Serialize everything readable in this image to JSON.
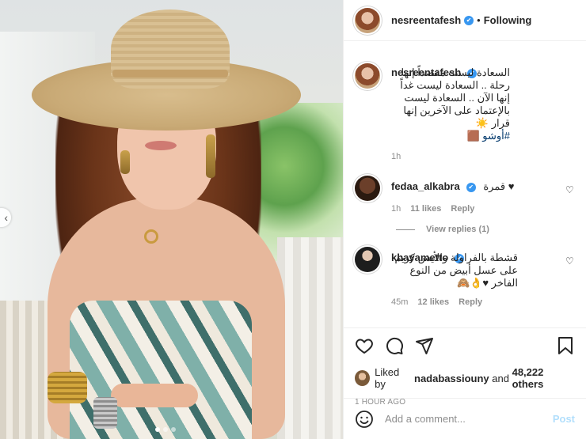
{
  "header": {
    "username": "nesreentafesh",
    "separator": "•",
    "follow_status": "Following"
  },
  "caption": {
    "username": "nesreentafesh",
    "text": "السعادة ليست مقصداً إنها رحلة .. السعادة ليست غداً إنها الآن .. السعادة ليست بالإعتماد على الآخرين إنها قرار ☀️",
    "hashtag": "#أوشو 🟫",
    "time": "1h"
  },
  "comments": [
    {
      "username": "fedaa_alkabra",
      "text": "قمرة ♥",
      "time": "1h",
      "likes": "11 likes",
      "reply": "Reply"
    },
    {
      "username": "khayametto",
      "text": "قشطة بالفراولة والأيس كريم على عسل أبيض من النوع الفاخر ♥👌🙈",
      "time": "45m",
      "likes": "12 likes",
      "reply": "Reply"
    }
  ],
  "view_replies": "View replies (1)",
  "liked_by": {
    "prefix": "Liked by",
    "user": "nadabassiouny",
    "and": "and",
    "others": "48,222 others"
  },
  "post_time": "1 HOUR AGO",
  "add_comment": {
    "placeholder": "Add a comment...",
    "post_label": "Post"
  },
  "carousel": {
    "nav": "‹"
  },
  "colors": {
    "verified": "#3897f0",
    "muted": "#8e8e8e",
    "post_disabled": "#b2dffc"
  }
}
